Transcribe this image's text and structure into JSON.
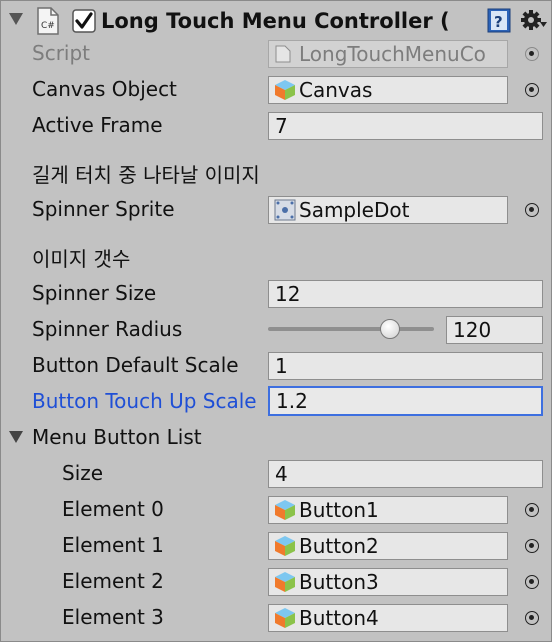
{
  "header": {
    "title": "Long Touch Menu Controller (",
    "enabled": true,
    "script_icon_text": "C#"
  },
  "script": {
    "label": "Script",
    "value": "LongTouchMenuCo"
  },
  "canvas_object": {
    "label": "Canvas Object",
    "value": "Canvas"
  },
  "active_frame": {
    "label": "Active Frame",
    "value": "7"
  },
  "header_image": {
    "text": "길게 터치 중 나타날 이미지"
  },
  "spinner_sprite": {
    "label": "Spinner Sprite",
    "value": "SampleDot"
  },
  "header_count": {
    "text": "이미지 갯수"
  },
  "spinner_size": {
    "label": "Spinner Size",
    "value": "12"
  },
  "spinner_radius": {
    "label": "Spinner Radius",
    "value": "120",
    "slider_fraction": 0.77
  },
  "button_default_scale": {
    "label": "Button Default Scale",
    "value": "1"
  },
  "button_touch_up_scale": {
    "label": "Button Touch Up Scale",
    "value": "1.2"
  },
  "menu_button_list": {
    "label": "Menu Button List",
    "size_label": "Size",
    "size_value": "4",
    "elements": [
      {
        "label": "Element 0",
        "value": "Button1"
      },
      {
        "label": "Element 1",
        "value": "Button2"
      },
      {
        "label": "Element 2",
        "value": "Button3"
      },
      {
        "label": "Element 3",
        "value": "Button4"
      }
    ]
  },
  "colors": {
    "background": "#c2c2c2",
    "field": "#e7e7e7",
    "focus_blue": "#3d6fe0",
    "label_blue": "#1f4fd6",
    "checkbox_blue": "#2a6be0"
  }
}
